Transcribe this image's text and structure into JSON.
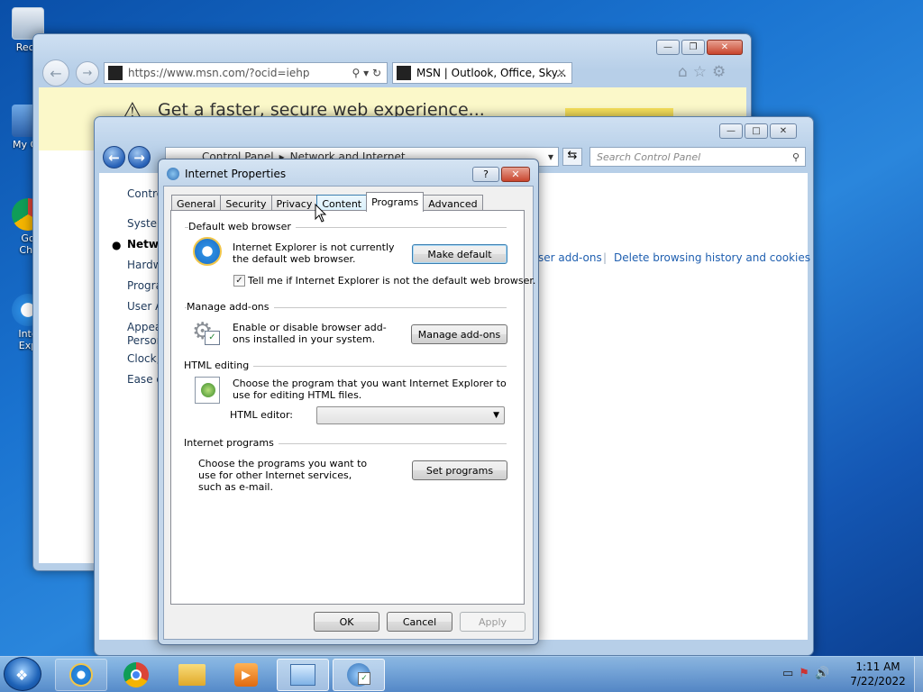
{
  "desktop": {
    "icons": [
      {
        "label": "Recy"
      },
      {
        "label": "My Co"
      },
      {
        "label": "Go\nChr"
      },
      {
        "label": "Inte\nExp"
      }
    ]
  },
  "ie": {
    "address": "https://www.msn.com/?ocid=iehp",
    "tab_title": "MSN | Outlook, Office, Sky...",
    "banner": "Get a faster, secure web experience..."
  },
  "control_panel": {
    "breadcrumb": [
      "Control Panel",
      "Network and Internet"
    ],
    "search_placeholder": "Search Control Panel",
    "sidebar": [
      "Contro",
      "System",
      "Netwo",
      "Hardw",
      "Progra",
      "User A",
      "Appea",
      "Person",
      "Clock,",
      "Ease o"
    ],
    "links": {
      "addons": "ser add-ons",
      "history": "Delete browsing history and cookies"
    }
  },
  "dialog": {
    "title": "Internet Properties",
    "help": "?",
    "tabs": [
      "General",
      "Security",
      "Privacy",
      "Content",
      "Programs",
      "Advanced"
    ],
    "active_tab": "Programs",
    "default_browser": {
      "group": "Default web browser",
      "text": "Internet Explorer is not currently the default web browser.",
      "button": "Make default",
      "checkbox_label": "Tell me if Internet Explorer is not the default web browser.",
      "checked": true
    },
    "addons": {
      "group": "Manage add-ons",
      "text": "Enable or disable browser add-ons installed in your system.",
      "button": "Manage add-ons"
    },
    "html_editing": {
      "group": "HTML editing",
      "text": "Choose the program that you want Internet Explorer to use for editing HTML files.",
      "label": "HTML editor:",
      "value": ""
    },
    "internet_programs": {
      "group": "Internet programs",
      "text": "Choose the programs you want to use for other Internet services, such as e-mail.",
      "button": "Set programs"
    },
    "ok": "OK",
    "cancel": "Cancel",
    "apply": "Apply"
  },
  "taskbar": {
    "time": "1:11 AM",
    "date": "7/22/2022"
  },
  "colors": {
    "link": "#1f5fb0",
    "accent": "#3c7fb1"
  }
}
